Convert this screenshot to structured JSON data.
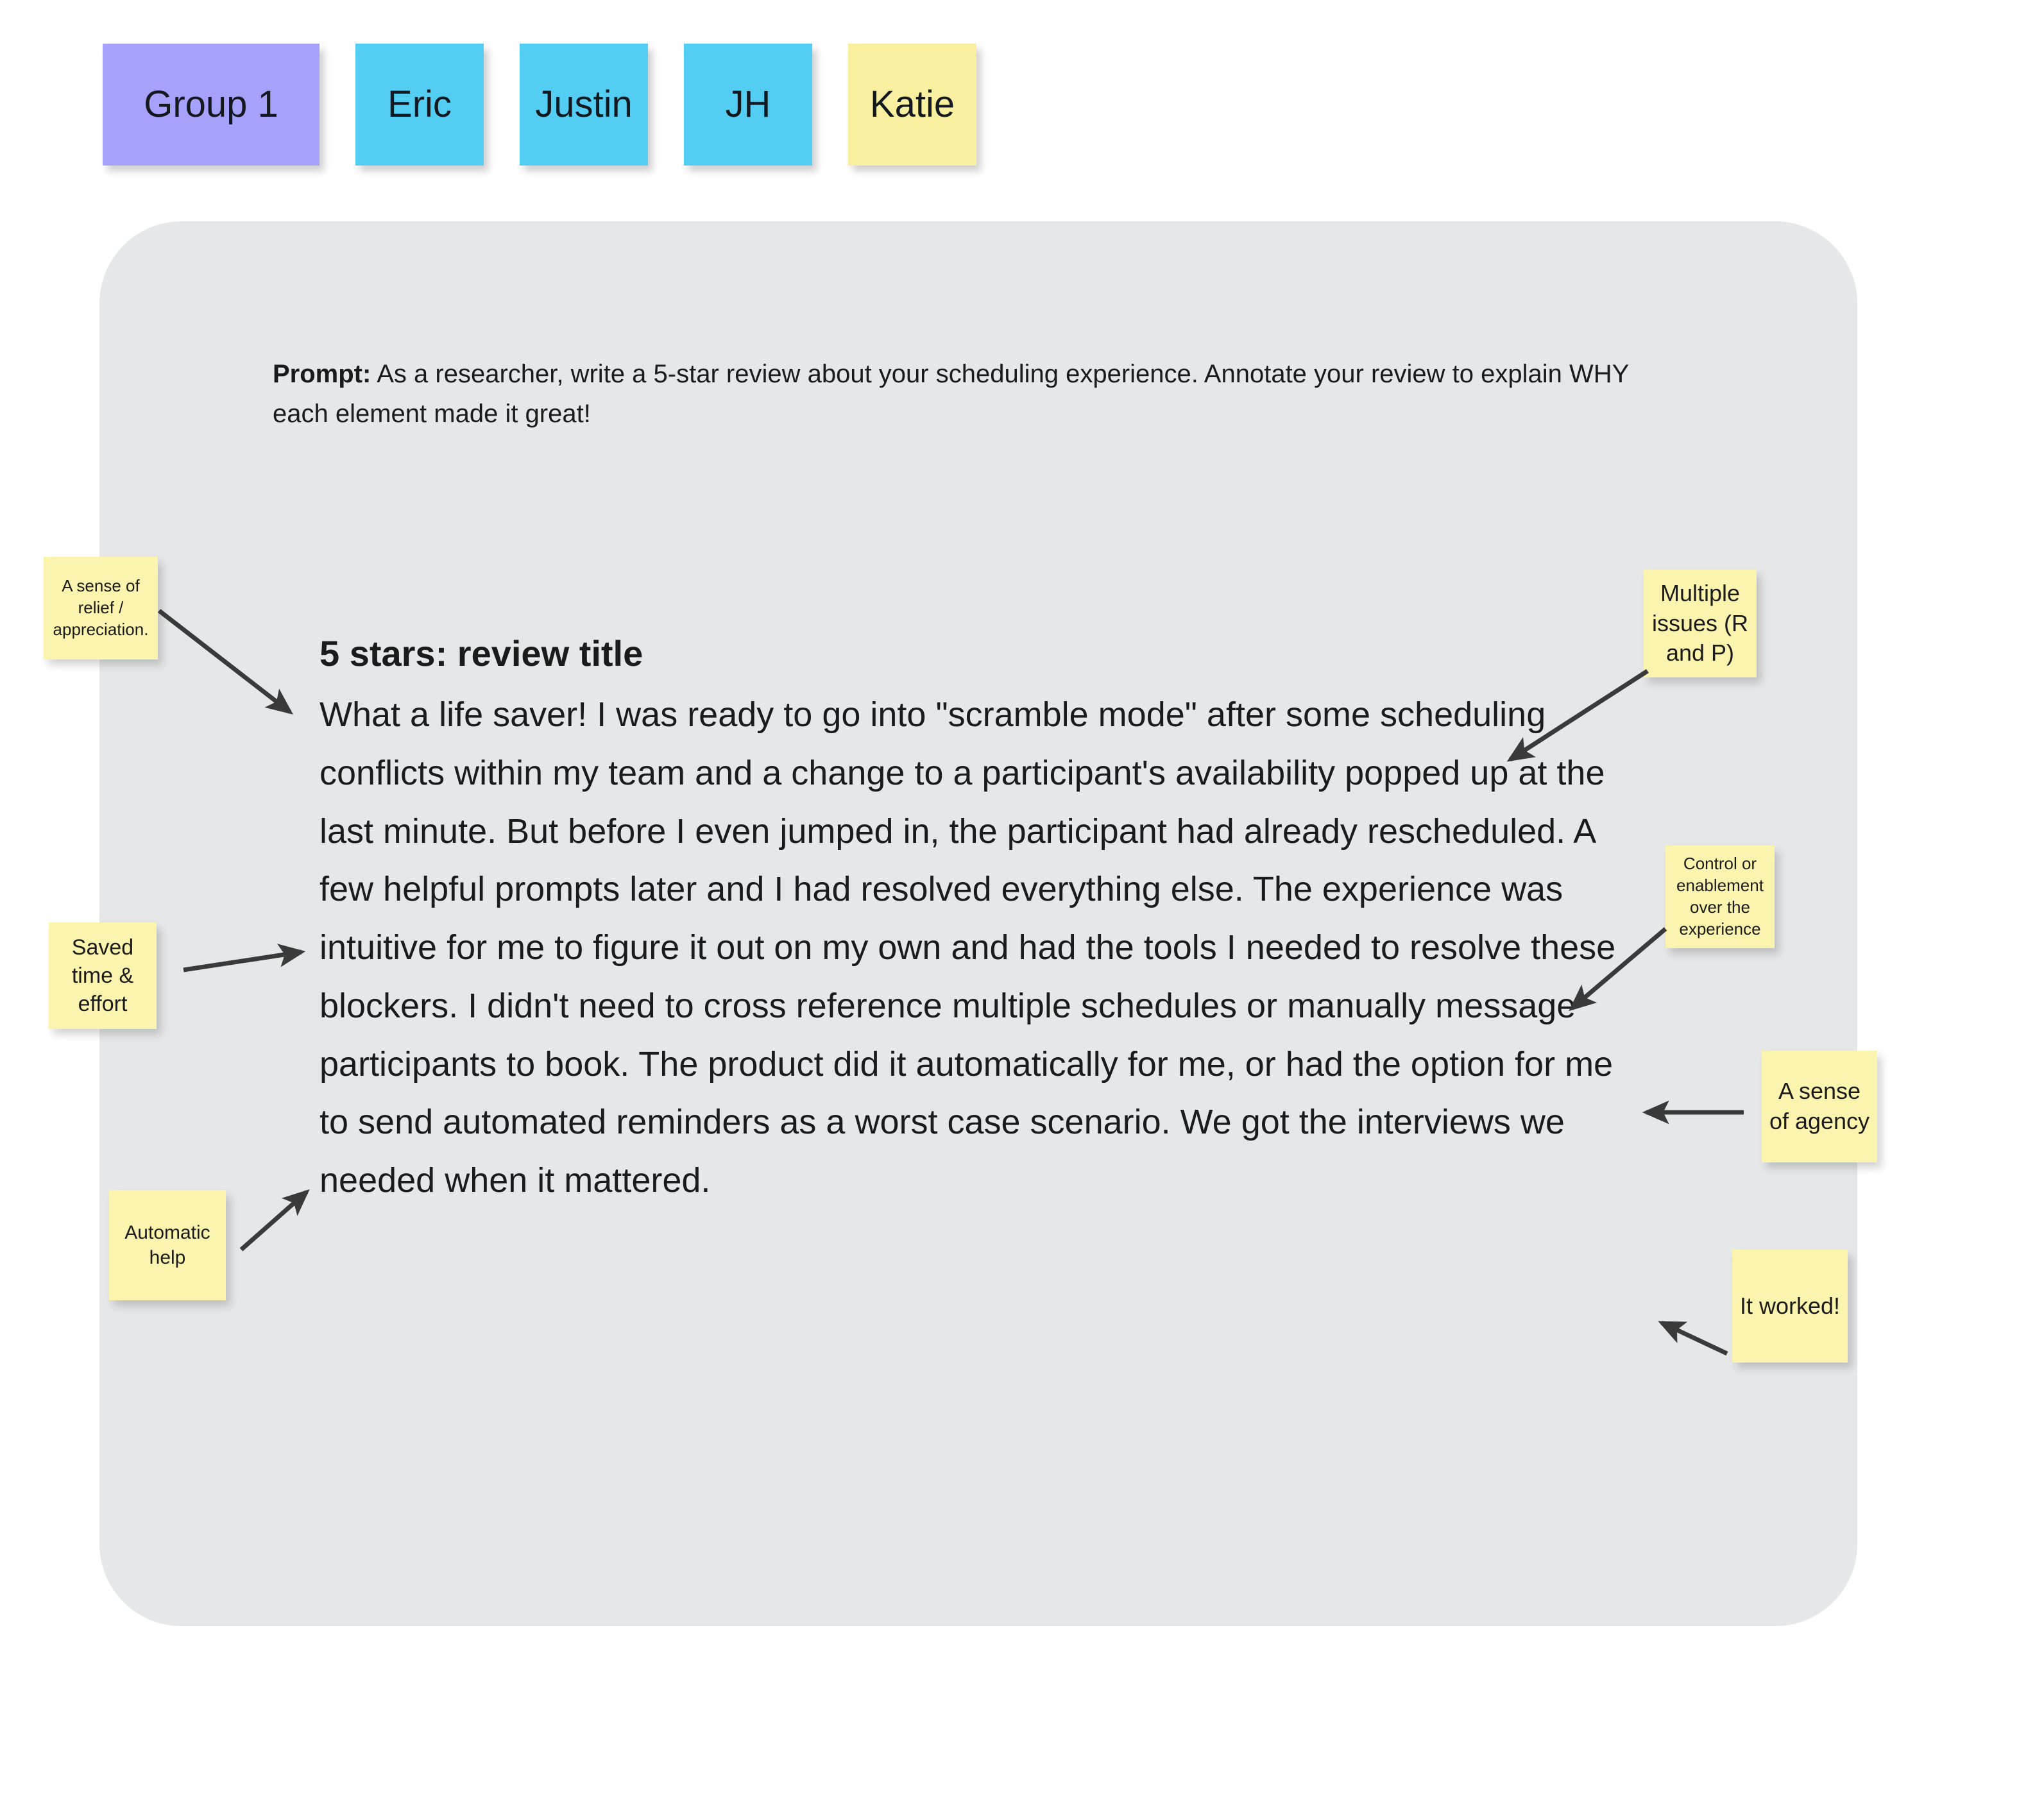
{
  "header": {
    "notes": [
      {
        "label": "Group 1",
        "color": "#a6a1fb",
        "kind": "group"
      },
      {
        "label": "Eric",
        "color": "#53cdf2",
        "kind": "person"
      },
      {
        "label": "Justin",
        "color": "#53cdf2",
        "kind": "person"
      },
      {
        "label": "JH",
        "color": "#53cdf2",
        "kind": "person"
      },
      {
        "label": "Katie",
        "color": "#f8f0a0",
        "kind": "person"
      }
    ]
  },
  "card": {
    "background_color": "#e6e7e8",
    "prompt": {
      "label": "Prompt:",
      "text": " As a researcher, write a 5-star review about your scheduling experience. Annotate your review to explain WHY each element made it great!"
    },
    "review": {
      "title": "5 stars: review title",
      "body": "What a life saver! I was ready to go into \"scramble mode\" after some scheduling conflicts within my team and a change to a participant's availability popped up at the last minute. But before I even jumped in, the participant had already rescheduled. A few helpful prompts later and I had resolved everything else. The experience was intuitive for me to figure it out on my own and had the tools I needed to resolve these blockers. I didn't need to cross reference multiple schedules or manually message participants to book. The product did it automatically for me, or had the option for me to send automated reminders as a worst case scenario. We got the interviews we needed when it mattered."
    }
  },
  "annotations": {
    "note_color": "#fbf4ae",
    "arrow_color": "#3a3a3a",
    "items": [
      {
        "id": "relief",
        "text": "A sense of relief / appreciation.",
        "side": "left"
      },
      {
        "id": "saved",
        "text": "Saved time & effort",
        "side": "left"
      },
      {
        "id": "automatic",
        "text": "Automatic help",
        "side": "left"
      },
      {
        "id": "multiple",
        "text": "Multiple issues (R and P)",
        "side": "right"
      },
      {
        "id": "control",
        "text": "Control or enablement over the experience",
        "side": "right"
      },
      {
        "id": "agency",
        "text": "A sense of agency",
        "side": "right"
      },
      {
        "id": "itworked",
        "text": "It worked!",
        "side": "right"
      }
    ]
  }
}
